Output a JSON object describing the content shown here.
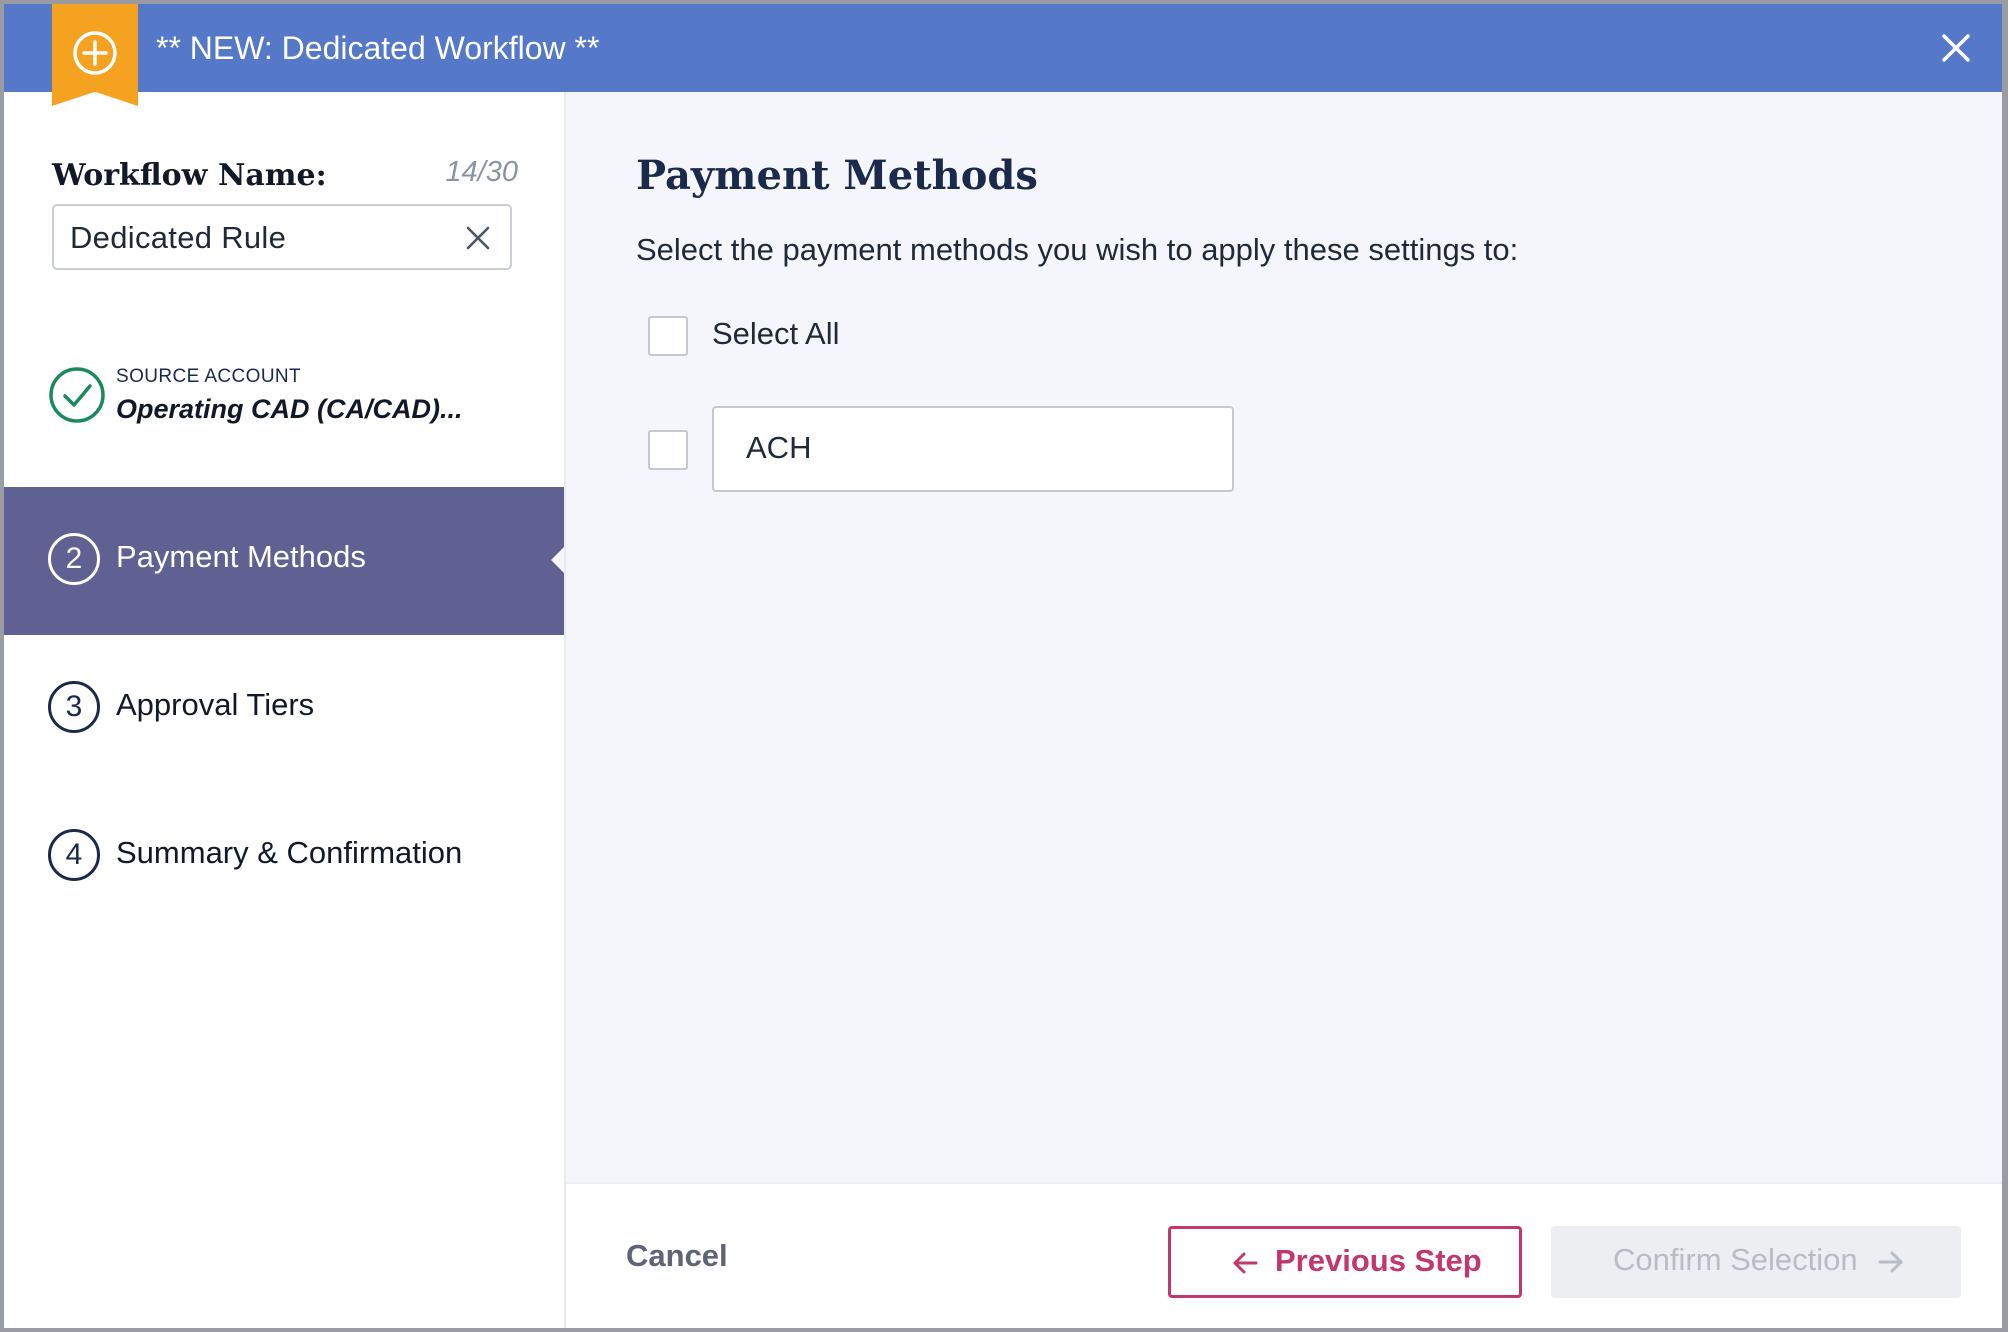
{
  "header": {
    "title": "** NEW: Dedicated Workflow **",
    "badge_icon": "plus-circle-icon",
    "close_icon": "close-icon",
    "colors": {
      "header_bg": "#5578c8",
      "badge_bg": "#f4a21f"
    }
  },
  "workflow": {
    "label": "Workflow Name:",
    "count": "14/30",
    "value": "Dedicated Rule"
  },
  "source": {
    "label": "SOURCE ACCOUNT",
    "value": "Operating CAD (CA/CAD)..."
  },
  "steps": [
    {
      "number": "2",
      "label": "Payment Methods",
      "active": true
    },
    {
      "number": "3",
      "label": "Approval Tiers",
      "active": false
    },
    {
      "number": "4",
      "label": "Summary & Confirmation",
      "active": false
    }
  ],
  "main": {
    "title": "Payment Methods",
    "description": "Select the payment methods you wish to apply these settings to:",
    "select_all_label": "Select All",
    "methods": [
      {
        "label": "ACH",
        "checked": false
      }
    ]
  },
  "footer": {
    "cancel": "Cancel",
    "previous": "Previous Step",
    "confirm": "Confirm Selection"
  },
  "colors": {
    "active_step": "#5e6191",
    "accent_pink": "#c2386e",
    "success_green": "#1a8a5a",
    "navy": "#1b2a4a"
  }
}
